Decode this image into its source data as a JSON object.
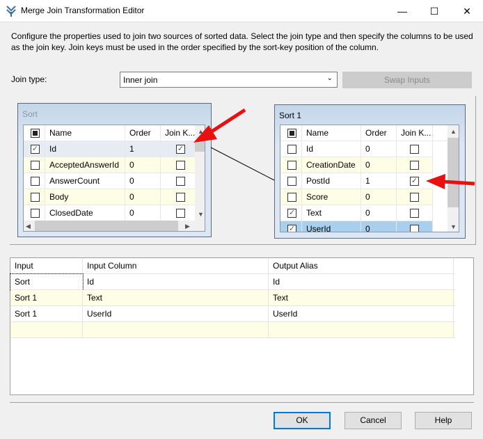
{
  "window": {
    "title": "Merge Join Transformation Editor",
    "minimize": "—",
    "maximize": "☐",
    "close": "✕"
  },
  "description": "Configure the properties used to join two sources of sorted data. Select the join type and then specify the columns to be used as the join key. Join keys must be used in the order specified by the sort-key position of the column.",
  "join_type": {
    "label": "Join type:",
    "value": "Inner join"
  },
  "swap_label": "Swap Inputs",
  "left_table": {
    "title": "Sort",
    "headers": [
      "Name",
      "Order",
      "Join K..."
    ],
    "rows": [
      {
        "name": "Id",
        "order": "1",
        "selected": true,
        "join": true
      },
      {
        "name": "AcceptedAnswerId",
        "order": "0",
        "selected": false,
        "join": false
      },
      {
        "name": "AnswerCount",
        "order": "0",
        "selected": false,
        "join": false
      },
      {
        "name": "Body",
        "order": "0",
        "selected": false,
        "join": false
      },
      {
        "name": "ClosedDate",
        "order": "0",
        "selected": false,
        "join": false
      }
    ]
  },
  "right_table": {
    "title": "Sort 1",
    "headers": [
      "Name",
      "Order",
      "Join K..."
    ],
    "rows": [
      {
        "name": "Id",
        "order": "0",
        "selected": false,
        "join": false
      },
      {
        "name": "CreationDate",
        "order": "0",
        "selected": false,
        "join": false
      },
      {
        "name": "PostId",
        "order": "1",
        "selected": false,
        "join": true
      },
      {
        "name": "Score",
        "order": "0",
        "selected": false,
        "join": false
      },
      {
        "name": "Text",
        "order": "0",
        "selected": true,
        "join": false
      },
      {
        "name": "UserId",
        "order": "0",
        "selected": true,
        "join": false
      }
    ]
  },
  "output_grid": {
    "headers": [
      "Input",
      "Input Column",
      "Output Alias"
    ],
    "rows": [
      [
        "Sort",
        "Id",
        "Id"
      ],
      [
        "Sort 1",
        "Text",
        "Text"
      ],
      [
        "Sort 1",
        "UserId",
        "UserId"
      ]
    ]
  },
  "buttons": {
    "ok": "OK",
    "cancel": "Cancel",
    "help": "Help"
  },
  "colors": {
    "arrow": "#e81010",
    "alt_row": "#fefee6",
    "selected_row": "#a9cfee"
  }
}
